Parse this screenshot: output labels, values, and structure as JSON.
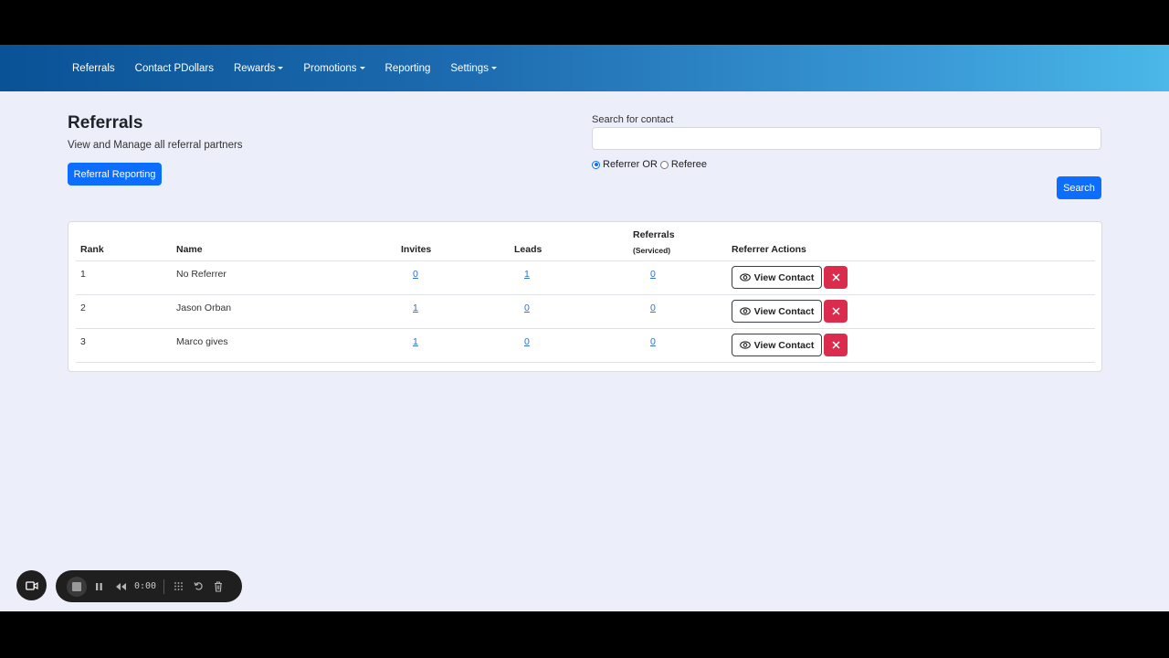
{
  "nav": {
    "items": [
      {
        "label": "Referrals",
        "dropdown": false
      },
      {
        "label": "Contact PDollars",
        "dropdown": false
      },
      {
        "label": "Rewards",
        "dropdown": true
      },
      {
        "label": "Promotions",
        "dropdown": true
      },
      {
        "label": "Reporting",
        "dropdown": false
      },
      {
        "label": "Settings",
        "dropdown": true
      }
    ]
  },
  "header": {
    "title": "Referrals",
    "subtitle": "View and Manage all referral partners",
    "reporting_button": "Referral Reporting"
  },
  "search": {
    "label": "Search for contact",
    "value": "",
    "radio_referrer": "Referrer OR",
    "radio_referee": "Referee",
    "selected": "referrer",
    "button": "Search"
  },
  "table": {
    "headers": {
      "rank": "Rank",
      "name": "Name",
      "invites": "Invites",
      "leads": "Leads",
      "referrals": "Referrals",
      "referrals_sub": "(Serviced)",
      "actions": "Referrer Actions"
    },
    "rows": [
      {
        "rank": "1",
        "name": "No Referrer",
        "invites": "0",
        "leads": "1",
        "referrals": "0"
      },
      {
        "rank": "2",
        "name": "Jason Orban",
        "invites": "1",
        "leads": "0",
        "referrals": "0"
      },
      {
        "rank": "3",
        "name": "Marco gives",
        "invites": "1",
        "leads": "0",
        "referrals": "0"
      }
    ],
    "view_button": "View Contact"
  },
  "recorder": {
    "time": "0:00"
  },
  "colors": {
    "primary": "#0d6efd",
    "danger": "#dc2c4d",
    "background": "#eceef9",
    "link": "#2f6fd0"
  },
  "icons": [
    "eye-icon",
    "close-icon",
    "video-camera-icon",
    "stop-icon",
    "pause-icon",
    "rewind-icon",
    "grid-icon",
    "restart-icon",
    "trash-icon"
  ]
}
